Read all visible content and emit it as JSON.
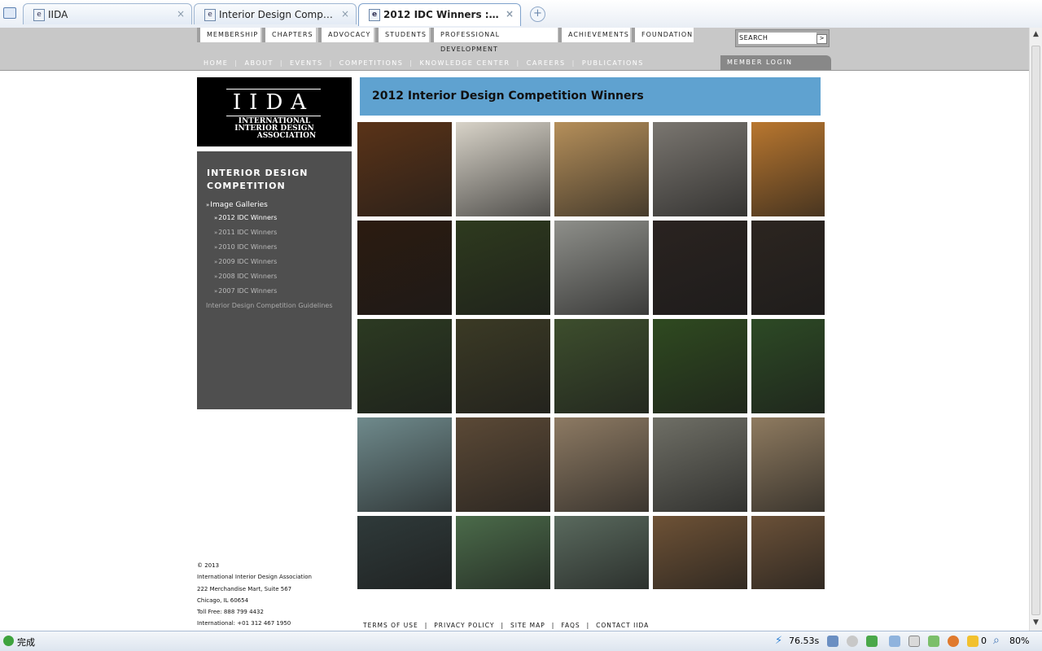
{
  "browser": {
    "tabs": [
      {
        "label": "IIDA",
        "active": false
      },
      {
        "label": "Interior Design Competition...",
        "active": false
      },
      {
        "label": "2012 IDC Winners : Ima...",
        "active": true
      }
    ],
    "close_glyph": "×",
    "new_tab_glyph": "+",
    "favicon_glyph": "e"
  },
  "header": {
    "top_tabs": [
      "MEMBERSHIP",
      "CHAPTERS",
      "ADVOCACY",
      "STUDENTS",
      "PROFESSIONAL DEVELOPMENT",
      "ACHIEVEMENTS",
      "FOUNDATION"
    ],
    "search_label": "SEARCH",
    "search_go": ">",
    "sub_nav": [
      "HOME",
      "ABOUT",
      "EVENTS",
      "COMPETITIONS",
      "KNOWLEDGE CENTER",
      "CAREERS",
      "PUBLICATIONS"
    ],
    "sub_nav_separator": "|",
    "member_login": "MEMBER LOGIN"
  },
  "logo": {
    "mark": "IIDA",
    "line1": "INTERNATIONAL",
    "line2": "INTERIOR DESIGN",
    "line3": "ASSOCIATION"
  },
  "sidebar": {
    "heading": "INTERIOR DESIGN COMPETITION",
    "gallery_label": "Image Galleries",
    "years": [
      {
        "label": "2012 IDC Winners",
        "current": true
      },
      {
        "label": "2011 IDC Winners",
        "current": false
      },
      {
        "label": "2010 IDC Winners",
        "current": false
      },
      {
        "label": "2009 IDC Winners",
        "current": false
      },
      {
        "label": "2008 IDC Winners",
        "current": false
      },
      {
        "label": "2007 IDC Winners",
        "current": false
      }
    ],
    "guidelines": "Interior Design Competition Guidelines",
    "arrow_glyph": "»"
  },
  "main": {
    "title": "2012 Interior Design Competition Winners",
    "thumbnail_colors": [
      [
        "#5a3318",
        "#d8d3c8",
        "#b58f5a",
        "#7a7670",
        "#b9772f"
      ],
      [
        "#2b1b10",
        "#2e3a1e",
        "#8e8f8a",
        "#2a2320",
        "#2c2520"
      ],
      [
        "#2c3a22",
        "#3b3a25",
        "#3d4e2d",
        "#2f4a20",
        "#2d4a25"
      ],
      [
        "#6f8a8c",
        "#5b4936",
        "#8d7a63",
        "#6f6f66",
        "#8f7b60"
      ],
      [
        "#2f3a3a",
        "#4b6b4a",
        "#5a6a5e",
        "#6e5236",
        "#6b5138"
      ]
    ]
  },
  "footer": {
    "address_lines": [
      "© 2013",
      "International Interior Design Association",
      "222 Merchandise Mart, Suite 567",
      "Chicago, IL 60654",
      "Toll Free: 888 799 4432",
      "International: +01 312 467 1950"
    ],
    "links": [
      "TERMS OF USE",
      "PRIVACY POLICY",
      "SITE MAP",
      "FAQS",
      "CONTACT IIDA"
    ],
    "link_separator": "|"
  },
  "statusbar": {
    "status_text": "完成",
    "load_time": "76.53s",
    "counter": "0",
    "zoom": "80%"
  },
  "scrollbar": {
    "up_glyph": "▲",
    "down_glyph": "▼"
  }
}
